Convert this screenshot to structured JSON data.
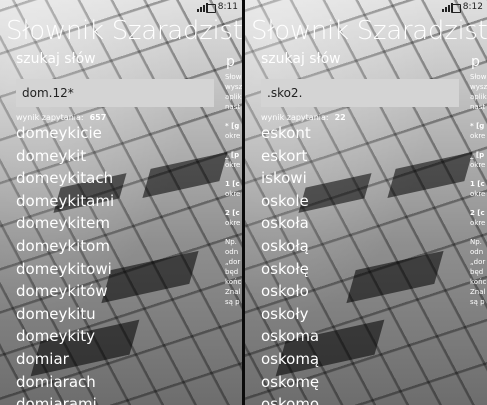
{
  "screens": [
    {
      "status": {
        "time": "8:11"
      },
      "app_title": "Słownik Szaradzisty",
      "pivot_current": "szukaj słów",
      "pivot_next": "p",
      "search_value": "dom.12*",
      "result_count_label": "wynik zapytania:",
      "result_count": "657",
      "results": [
        "domeykicie",
        "domeykit",
        "domeykitach",
        "domeykitami",
        "domeykitem",
        "domeykitom",
        "domeykitowi",
        "domeykitów",
        "domeykitu",
        "domeykity",
        "domiar",
        "domiarach",
        "domiarami"
      ],
      "peek_lines": [
        "Słow",
        "wysz",
        "aplik",
        "nast",
        "* [g",
        "okre",
        "_ [p",
        "okre",
        "1 [c",
        "okre",
        "2 [c",
        "okre",
        "Np.",
        "odn",
        "„dor",
        "będ",
        "końc",
        "Znal",
        "są p"
      ]
    },
    {
      "status": {
        "time": "8:12"
      },
      "app_title": "Słownik Szaradzisty",
      "pivot_current": "szukaj słów",
      "pivot_next": "p",
      "search_value": ".sko2.",
      "result_count_label": "wynik zapytania:",
      "result_count": "22",
      "results": [
        "eskont",
        "eskort",
        "iskowi",
        "oskole",
        "oskoła",
        "oskołą",
        "oskołę",
        "oskoło",
        "oskoły",
        "oskoma",
        "oskomą",
        "oskomę",
        "oskomo"
      ],
      "peek_lines": [
        "Słow",
        "wysz",
        "aplik",
        "nast",
        "* [g",
        "okre",
        "_ [p",
        "okre",
        "1 [c",
        "okre",
        "2 [c",
        "okre",
        "Np.",
        "odn",
        "„dor",
        "będ",
        "końc",
        "Znal",
        "są p"
      ]
    }
  ]
}
